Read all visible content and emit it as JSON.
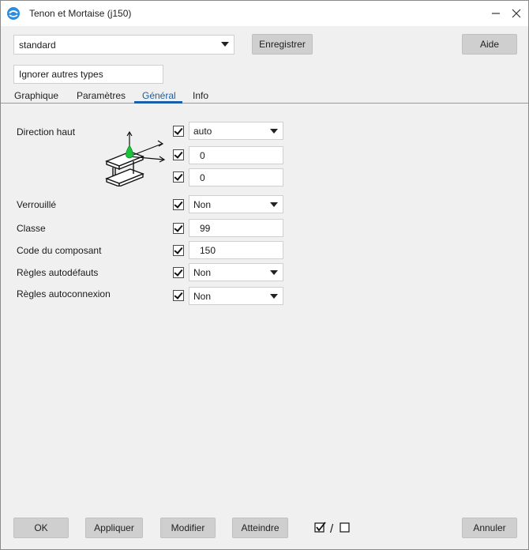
{
  "window": {
    "title": "Tenon et Mortaise (j150)",
    "minimize_icon": "minimize-icon",
    "close_icon": "close-icon"
  },
  "header": {
    "preset": "standard",
    "save_label": "Enregistrer",
    "help_label": "Aide",
    "filter": "Ignorer autres types"
  },
  "tabs": [
    {
      "label": "Graphique",
      "active": false
    },
    {
      "label": "Paramètres",
      "active": false
    },
    {
      "label": "Général",
      "active": true
    },
    {
      "label": "Info",
      "active": false
    }
  ],
  "general": {
    "direction": {
      "label": "Direction haut",
      "value": "auto",
      "offset1": "0",
      "offset2": "0",
      "icon": "beam-orientation-icon"
    },
    "locked": {
      "label": "Verrouillé",
      "value": "Non"
    },
    "class": {
      "label": "Classe",
      "value": "99"
    },
    "component_code": {
      "label": "Code du composant",
      "value": "150"
    },
    "auto_defaults": {
      "label": "Règles autodéfauts",
      "value": "Non"
    },
    "auto_connection": {
      "label": "Règles autoconnexion",
      "value": "Non"
    }
  },
  "footer": {
    "ok_label": "OK",
    "apply_label": "Appliquer",
    "modify_label": "Modifier",
    "get_label": "Atteindre",
    "cancel_label": "Annuler",
    "toggle_separator": "/"
  },
  "colors": {
    "accent": "#1b5ea8",
    "button_bg": "#cfcfcf",
    "dialog_bg": "#f0f0f0",
    "axis_green": "#19c43a"
  }
}
